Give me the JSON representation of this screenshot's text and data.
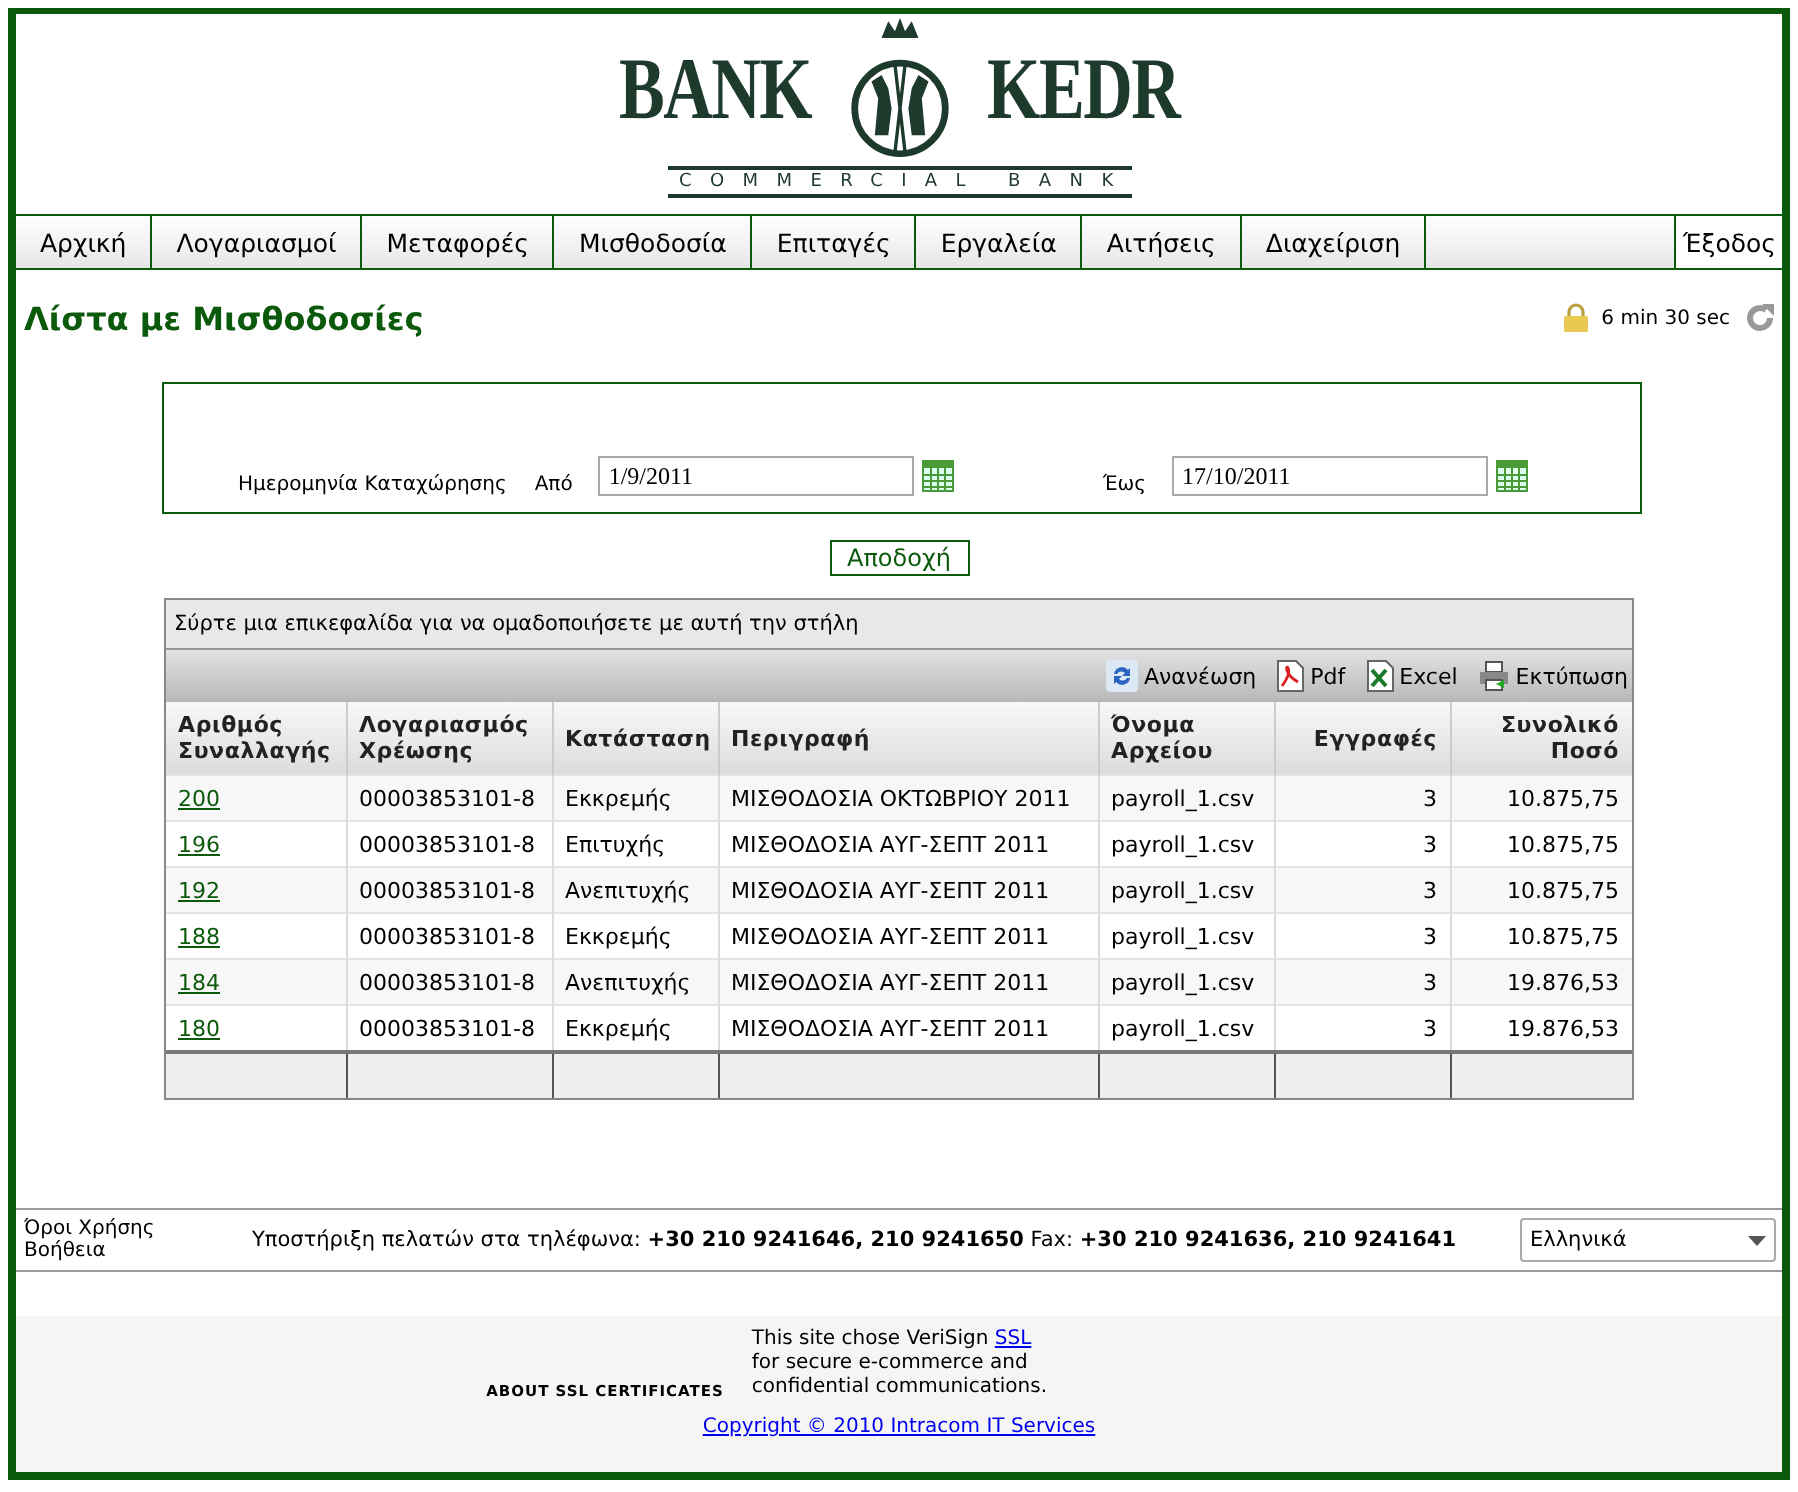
{
  "logo": {
    "left": "BANK",
    "right": "KEDR",
    "tagline": "COMMERCIAL BANK"
  },
  "nav": {
    "items": [
      {
        "label": "Αρχική"
      },
      {
        "label": "Λογαριασμοί"
      },
      {
        "label": "Μεταφορές"
      },
      {
        "label": "Μισθοδοσία"
      },
      {
        "label": "Επιταγές"
      },
      {
        "label": "Εργαλεία"
      },
      {
        "label": "Αιτήσεις"
      },
      {
        "label": "Διαχείριση"
      }
    ],
    "logout": "Έξοδος"
  },
  "page": {
    "title": "Λίστα με Μισθοδοσίες",
    "session": "6 min 30 sec"
  },
  "filter": {
    "label": "Ημερομηνία Καταχώρησης",
    "from_label": "Από",
    "from_value": "1/9/2011",
    "to_label": "Έως",
    "to_value": "17/10/2011",
    "submit": "Αποδοχή"
  },
  "grid": {
    "group_hint": "Σύρτε μια επικεφαλίδα για να ομαδοποιήσετε με αυτή την στήλη",
    "toolbar": [
      {
        "kind": "refresh",
        "label": "Ανανέωση"
      },
      {
        "kind": "pdf",
        "label": "Pdf"
      },
      {
        "kind": "excel",
        "label": "Excel"
      },
      {
        "kind": "print",
        "label": "Εκτύπωση"
      }
    ],
    "columns": [
      {
        "label": "Αριθμός Συναλλαγής"
      },
      {
        "label": "Λογαριασμός Χρέωσης"
      },
      {
        "label": "Κατάσταση"
      },
      {
        "label": "Περιγραφή"
      },
      {
        "label": "Όνομα Αρχείου"
      },
      {
        "label": "Εγγραφές"
      },
      {
        "label": "Συνολικό Ποσό"
      }
    ],
    "rows": [
      [
        "200",
        "00003853101-8",
        "Εκκρεμής",
        "ΜΙΣΘΟΔΟΣΙΑ ΟΚΤΩΒΡΙΟΥ 2011",
        "payroll_1.csv",
        "3",
        "10.875,75"
      ],
      [
        "196",
        "00003853101-8",
        "Επιτυχής",
        "ΜΙΣΘΟΔΟΣΙΑ ΑΥΓ-ΣΕΠΤ 2011",
        "payroll_1.csv",
        "3",
        "10.875,75"
      ],
      [
        "192",
        "00003853101-8",
        "Ανεπιτυχής",
        "ΜΙΣΘΟΔΟΣΙΑ ΑΥΓ-ΣΕΠΤ 2011",
        "payroll_1.csv",
        "3",
        "10.875,75"
      ],
      [
        "188",
        "00003853101-8",
        "Εκκρεμής",
        "ΜΙΣΘΟΔΟΣΙΑ ΑΥΓ-ΣΕΠΤ 2011",
        "payroll_1.csv",
        "3",
        "10.875,75"
      ],
      [
        "184",
        "00003853101-8",
        "Ανεπιτυχής",
        "ΜΙΣΘΟΔΟΣΙΑ ΑΥΓ-ΣΕΠΤ 2011",
        "payroll_1.csv",
        "3",
        "19.876,53"
      ],
      [
        "180",
        "00003853101-8",
        "Εκκρεμής",
        "ΜΙΣΘΟΔΟΣΙΑ ΑΥΓ-ΣΕΠΤ 2011",
        "payroll_1.csv",
        "3",
        "19.876,53"
      ]
    ]
  },
  "footer": {
    "links": [
      "Όροι Χρήσης",
      "Βοήθεια"
    ],
    "support": "Υποστήριξη πελατών στα τηλέφωνα: **+30 210 9241646, 210 9241650** Fax: **+30 210 9241636, 210 9241641**",
    "language": "Ελληνικά"
  },
  "ssl": {
    "about": "ABOUT SSL CERTIFICATES",
    "text_before": "This site chose VeriSign",
    "link": "SSL",
    "text_after": "for secure e-commerce and confidential communications.",
    "copyright": "Copyright © 2010 Intracom IT Services"
  }
}
